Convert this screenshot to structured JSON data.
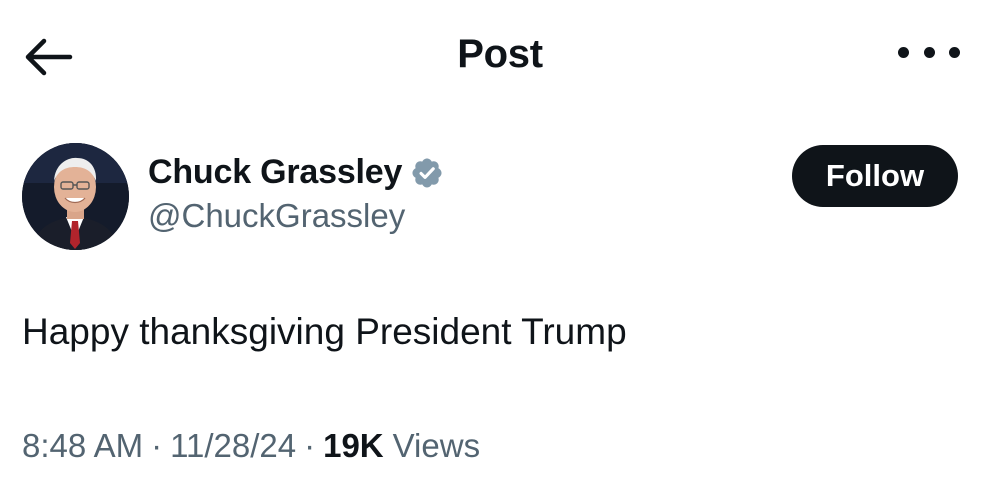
{
  "header": {
    "title": "Post",
    "back_icon": "arrow-left-icon",
    "more_icon": "more-horizontal-icon"
  },
  "author": {
    "name": "Chuck Grassley",
    "handle": "@ChuckGrassley",
    "verified_icon": "verified-badge-icon",
    "verified_color": "#829aab"
  },
  "follow_label": "Follow",
  "post": {
    "text": "Happy thanksgiving President Trump"
  },
  "meta": {
    "time": "8:48 AM",
    "separator": "·",
    "date": "11/28/24",
    "views_count": "19K",
    "views_label": "Views"
  }
}
